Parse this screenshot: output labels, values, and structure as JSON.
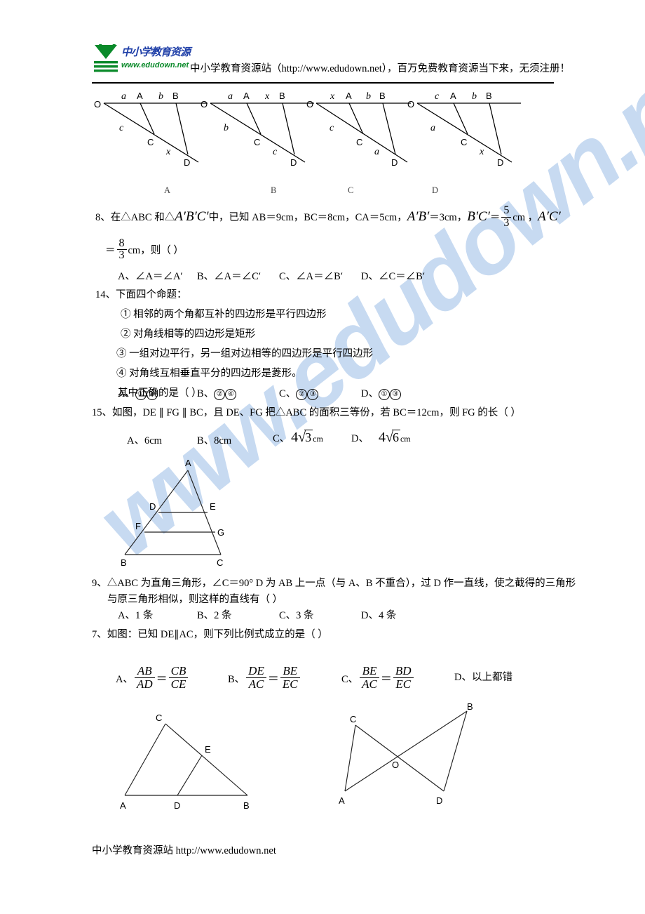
{
  "header": {
    "logo_cn": "中小学教育资源",
    "logo_url": "www.edudown.net",
    "title": "中小学教育资源站（http://www.edudown.net），百万免费教育资源当下来，无须注册！"
  },
  "watermark": {
    "text": "www.edudown.net"
  },
  "top_figures": {
    "captions": [
      "A",
      "B",
      "C",
      "D"
    ],
    "figures": [
      {
        "caption": "A",
        "vertex": "O",
        "ray_points": [
          "A",
          "B"
        ],
        "diag_points": [
          "C",
          "D"
        ],
        "seg_labels": {
          "top_first": "a",
          "top_second": "b",
          "diag_first": "c",
          "diag_second": "x"
        }
      },
      {
        "caption": "B",
        "vertex": "O",
        "ray_points": [
          "A",
          "B"
        ],
        "diag_points": [
          "C",
          "D"
        ],
        "seg_labels": {
          "top_first": "a",
          "top_second": "x",
          "diag_first": "b",
          "diag_second": "c"
        }
      },
      {
        "caption": "C",
        "vertex": "O",
        "ray_points": [
          "A",
          "B"
        ],
        "diag_points": [
          "C",
          "D"
        ],
        "seg_labels": {
          "top_first": "x",
          "top_second": "b",
          "diag_first": "c",
          "diag_second": "a"
        }
      },
      {
        "caption": "D",
        "vertex": "O",
        "ray_points": [
          "A",
          "B"
        ],
        "diag_points": [
          "C",
          "D"
        ],
        "seg_labels": {
          "top_first": "c",
          "top_second": "b",
          "diag_first": "a",
          "diag_second": "x"
        }
      }
    ]
  },
  "q8": {
    "line1_a": "8、在△ABC 和△",
    "tri2": "A′B′C′",
    "line1_b": "中，已知 AB＝9cm，BC＝8cm，CA＝5cm，",
    "ab_prime": "A′B′",
    "ab_prime_val": "＝3cm，",
    "bc_prime": "B′C′",
    "bc_eq": "＝",
    "bc_num": "5",
    "bc_den": "3",
    "bc_unit": "cm ，",
    "ac_prime": "A′C′",
    "line2_eq": "＝",
    "ac_num": "8",
    "ac_den": "3",
    "line2_tail": "cm，则（        ）",
    "options": [
      "A、∠A＝∠A′",
      "B、∠A＝∠C′",
      "C、∠A＝∠B′",
      "D、∠C＝∠B′"
    ]
  },
  "q14": {
    "stem": "14、下面四个命题：",
    "items": [
      {
        "num": "①",
        "text": "相邻的两个角都互补的四边形是平行四边形"
      },
      {
        "num": "②",
        "text": "对角线相等的四边形是矩形"
      },
      {
        "num": "③",
        "text": "一组对边平行，另一组对边相等的四边形是平行四边形"
      },
      {
        "num": "④",
        "text": "对角线互相垂直平分的四边形是菱形。"
      }
    ],
    "ask": "其中正确的是（        ）",
    "options": [
      {
        "prefix": "A、",
        "nums": [
          "①",
          "④"
        ]
      },
      {
        "prefix": "B、",
        "nums": [
          "②",
          "④"
        ]
      },
      {
        "prefix": "C、",
        "nums": [
          "②",
          "③"
        ]
      },
      {
        "prefix": "D、",
        "nums": [
          "①",
          "③"
        ]
      }
    ]
  },
  "q15": {
    "stem": "15、如图，DE ∥ FG ∥ BC，且 DE、FG 把△ABC 的面积三等份，若 BC＝12cm，则 FG 的长（        ）",
    "optA": "A、6cm",
    "optB": "B、8cm",
    "optC_prefix": "C、",
    "optC_coef": "4",
    "optC_rad": "3",
    "optC_unit": "cm",
    "optD_prefix": "D、",
    "optD_coef": "4",
    "optD_rad": "6",
    "optD_unit": "cm",
    "figure_labels": [
      "A",
      "D",
      "E",
      "F",
      "G",
      "B",
      "C"
    ]
  },
  "q9": {
    "line1": "9、△ABC 为直角三角形，∠C＝90° D 为 AB 上一点（与 A、B 不重合），过 D 作一直线，使之截得的三角形",
    "line2": "与原三角形相似，则这样的直线有（       ）",
    "options": [
      "A、1 条",
      "B、2 条",
      "C、3 条",
      "D、4 条"
    ]
  },
  "q7": {
    "stem": "7、如图：已知 DE∥AC，则下列比例式成立的是（       ）",
    "options": [
      {
        "prefix": "A、",
        "n1": "AB",
        "d1": "AD",
        "n2": "CB",
        "d2": "CE"
      },
      {
        "prefix": "B、",
        "n1": "DE",
        "d1": "AC",
        "n2": "BE",
        "d2": "EC"
      },
      {
        "prefix": "C、",
        "n1": "BE",
        "d1": "AC",
        "n2": "BD",
        "d2": "EC"
      },
      {
        "prefix": "D、",
        "text": "以上都错"
      }
    ],
    "figure_left_labels": [
      "C",
      "E",
      "A",
      "D",
      "B"
    ],
    "figure_right_labels": [
      "B",
      "C",
      "O",
      "A",
      "D"
    ]
  },
  "footer": {
    "text": "中小学教育资源站 http://www.edudown.net"
  }
}
